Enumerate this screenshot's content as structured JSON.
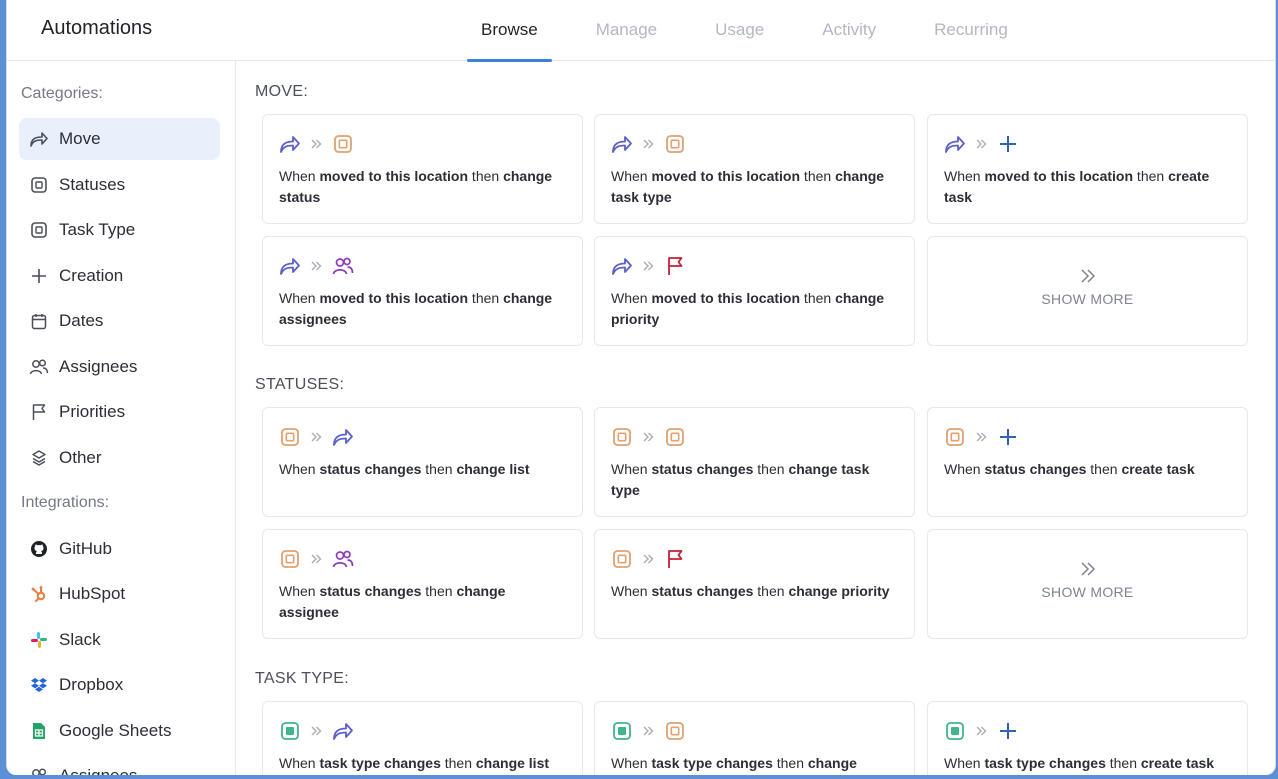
{
  "app": {
    "title": "Automations"
  },
  "tabs": [
    {
      "label": "Browse",
      "active": true
    },
    {
      "label": "Manage",
      "active": false
    },
    {
      "label": "Usage",
      "active": false
    },
    {
      "label": "Activity",
      "active": false
    },
    {
      "label": "Recurring",
      "active": false
    }
  ],
  "sidebar": {
    "categories_heading": "Categories:",
    "categories": [
      {
        "label": "Move",
        "icon": "move-arrow-icon",
        "active": true
      },
      {
        "label": "Statuses",
        "icon": "status-square-icon"
      },
      {
        "label": "Task Type",
        "icon": "task-type-square-icon"
      },
      {
        "label": "Creation",
        "icon": "plus-icon"
      },
      {
        "label": "Dates",
        "icon": "calendar-icon"
      },
      {
        "label": "Assignees",
        "icon": "users-icon"
      },
      {
        "label": "Priorities",
        "icon": "flag-icon"
      },
      {
        "label": "Other",
        "icon": "layers-icon"
      }
    ],
    "integrations_heading": "Integrations:",
    "integrations": [
      {
        "label": "GitHub",
        "icon": "github-icon"
      },
      {
        "label": "HubSpot",
        "icon": "hubspot-icon"
      },
      {
        "label": "Slack",
        "icon": "slack-icon"
      },
      {
        "label": "Dropbox",
        "icon": "dropbox-icon"
      },
      {
        "label": "Google Sheets",
        "icon": "google-sheets-icon"
      },
      {
        "label": "Assignees",
        "icon": "users-icon"
      }
    ]
  },
  "colors": {
    "accent": "#3d7fe0",
    "move": "#5b5fc7",
    "status": "#e0a070",
    "assignee": "#8e3fb5",
    "flag": "#c4203a",
    "plus": "#2f5fb8",
    "task_type": "#3fb58a"
  },
  "sections": [
    {
      "title": "MOVE:",
      "cards": [
        {
          "from": "move",
          "to": "status",
          "pre": "When",
          "trigger": "moved to this location",
          "mid": "then",
          "action": "change status"
        },
        {
          "from": "move",
          "to": "status",
          "pre": "When",
          "trigger": "moved to this location",
          "mid": "then",
          "action": "change task type"
        },
        {
          "from": "move",
          "to": "plus",
          "pre": "When",
          "trigger": "moved to this location",
          "mid": "then",
          "action": "create task"
        },
        {
          "from": "move",
          "to": "assignee",
          "pre": "When",
          "trigger": "moved to this location",
          "mid": "then",
          "action": "change assignees"
        },
        {
          "from": "move",
          "to": "flag",
          "pre": "When",
          "trigger": "moved to this location",
          "mid": "then",
          "action": "change priority"
        },
        {
          "show_more": "SHOW MORE"
        }
      ]
    },
    {
      "title": "STATUSES:",
      "cards": [
        {
          "from": "status",
          "to": "move",
          "pre": "When",
          "trigger": "status changes",
          "mid": "then",
          "action": "change list"
        },
        {
          "from": "status",
          "to": "status",
          "pre": "When",
          "trigger": "status changes",
          "mid": "then",
          "action": "change task type"
        },
        {
          "from": "status",
          "to": "plus",
          "pre": "When",
          "trigger": "status changes",
          "mid": "then",
          "action": "create task"
        },
        {
          "from": "status",
          "to": "assignee",
          "pre": "When",
          "trigger": "status changes",
          "mid": "then",
          "action": "change assignee"
        },
        {
          "from": "status",
          "to": "flag",
          "pre": "When",
          "trigger": "status changes",
          "mid": "then",
          "action": "change priority"
        },
        {
          "show_more": "SHOW MORE"
        }
      ]
    },
    {
      "title": "TASK TYPE:",
      "cards": [
        {
          "from": "tasktype",
          "to": "move",
          "pre": "When",
          "trigger": "task type changes",
          "mid": "then",
          "action": "change list"
        },
        {
          "from": "tasktype",
          "to": "status",
          "pre": "When",
          "trigger": "task type changes",
          "mid": "then",
          "action": "change"
        },
        {
          "from": "tasktype",
          "to": "plus",
          "pre": "When",
          "trigger": "task type changes",
          "mid": "then",
          "action": "create task"
        }
      ]
    }
  ]
}
